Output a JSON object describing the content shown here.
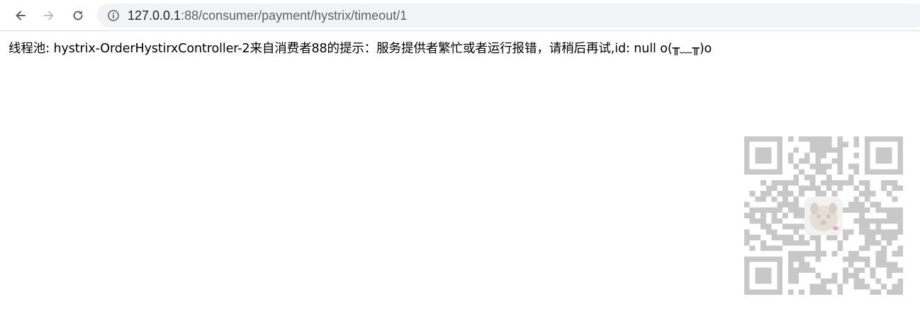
{
  "browser": {
    "url_host": "127.0.0.1",
    "url_path": ":88/consumer/payment/hystrix/timeout/1",
    "icons": {
      "back": "back-arrow-icon",
      "forward": "forward-arrow-icon",
      "reload": "reload-icon",
      "site_info": "info-icon"
    }
  },
  "page": {
    "message": "线程池: hystrix-OrderHystirxController-2来自消费者88的提示：服务提供者繁忙或者运行报错，请稍后再试,id: null o(╥﹏╥)o"
  },
  "overlay": {
    "qr_icon": "qr-code-icon",
    "center_image": "dog-avatar-image",
    "qr_color": "#c8c8c8"
  }
}
